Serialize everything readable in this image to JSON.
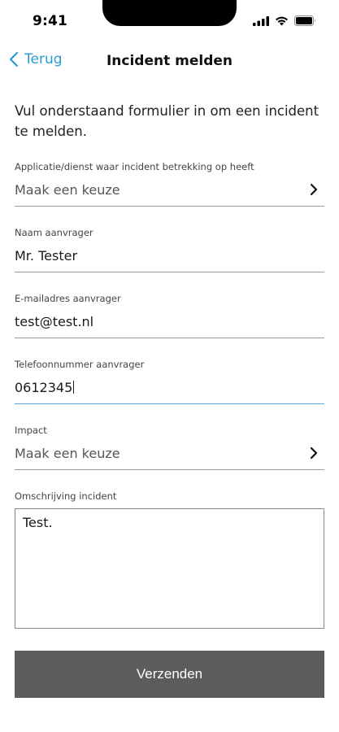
{
  "status_bar": {
    "time": "9:41",
    "icons": [
      "signal-icon",
      "wifi-icon",
      "battery-icon"
    ]
  },
  "nav": {
    "back_label": "Terug",
    "title": "Incident melden"
  },
  "intro": "Vul onderstaand formulier in om een incident te melden.",
  "form": {
    "application": {
      "label": "Applicatie/dienst waar incident betrekking op heeft",
      "placeholder": "Maak een keuze"
    },
    "name": {
      "label": "Naam aanvrager",
      "value": "Mr. Tester"
    },
    "email": {
      "label": "E-mailadres aanvrager",
      "value": "test@test.nl"
    },
    "phone": {
      "label": "Telefoonnummer aanvrager",
      "value": "0612345"
    },
    "impact": {
      "label": "Impact",
      "placeholder": "Maak een keuze"
    },
    "description": {
      "label": "Omschrijving incident",
      "value": "Test."
    }
  },
  "submit_label": "Verzenden",
  "colors": {
    "accent": "#2b9bd6",
    "active_underline": "#5aa4dc",
    "button_bg": "#5c5c5c"
  }
}
